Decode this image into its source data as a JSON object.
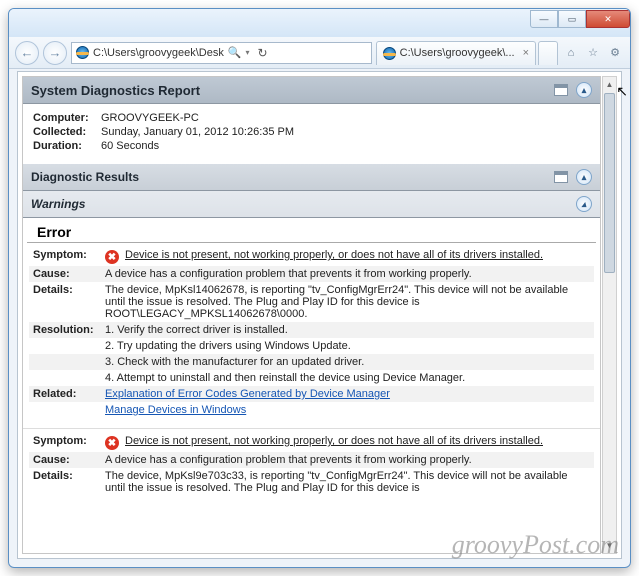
{
  "window": {
    "address": "C:\\Users\\groovygeek\\Desk",
    "tab_title": "C:\\Users\\groovygeek\\...",
    "tab_has_close": "×"
  },
  "report": {
    "header": "System Diagnostics Report",
    "computer_label": "Computer:",
    "computer_value": "GROOVYGEEK-PC",
    "collected_label": "Collected:",
    "collected_value": "Sunday, January 01, 2012 10:26:35 PM",
    "duration_label": "Duration:",
    "duration_value": "60 Seconds"
  },
  "diag": {
    "header": "Diagnostic Results",
    "warnings_header": "Warnings",
    "error_header": "Error"
  },
  "err1": {
    "symptom_label": "Symptom:",
    "symptom_text": "Device is not present, not working properly, or does not have all of its drivers installed.",
    "cause_label": "Cause:",
    "cause_text": "A device has a configuration problem that prevents it from working properly.",
    "details_label": "Details:",
    "details_text": "The device, MpKsl14062678, is reporting \"tv_ConfigMgrErr24\". This device will not be available until the issue is resolved. The Plug and Play ID for this device is ROOT\\LEGACY_MPKSL14062678\\0000.",
    "resolution_label": "Resolution:",
    "res1": "1. Verify the correct driver is installed.",
    "res2": "2. Try updating the drivers using Windows Update.",
    "res3": "3. Check with the manufacturer for an updated driver.",
    "res4": "4. Attempt to uninstall and then reinstall the device using Device Manager.",
    "related_label": "Related:",
    "related_link1": "Explanation of Error Codes Generated by Device Manager",
    "related_link2": "Manage Devices in Windows"
  },
  "err2": {
    "symptom_label": "Symptom:",
    "symptom_text": "Device is not present, not working properly, or does not have all of its drivers installed.",
    "cause_label": "Cause:",
    "cause_text": "A device has a configuration problem that prevents it from working properly.",
    "details_label": "Details:",
    "details_text": "The device, MpKsl9e703c33, is reporting \"tv_ConfigMgrErr24\". This device will not be available until the issue is resolved. The Plug and Play ID for this device is"
  },
  "watermark": "groovyPost.com"
}
